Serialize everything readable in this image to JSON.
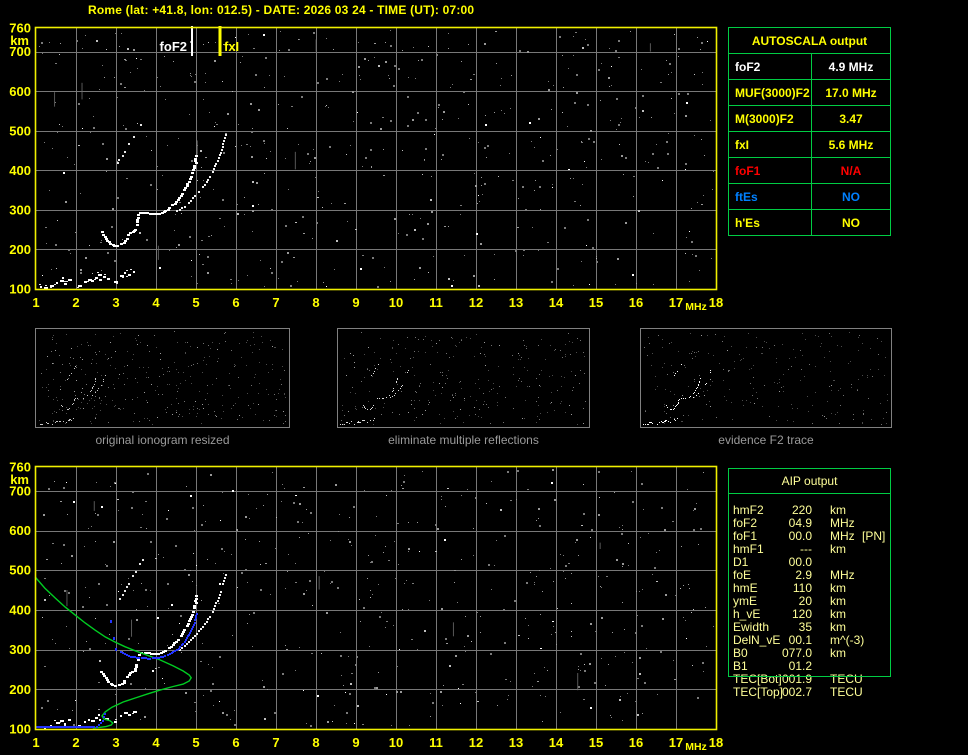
{
  "title": "Rome (lat: +41.8, lon: 012.5) - DATE: 2026 03 24 - TIME (UT): 07:00",
  "colors": {
    "background": "#000000",
    "title_yellow": "#ffff00",
    "plot_border_yellow": "#f0f000",
    "grid_gray": "#787878",
    "table_border_green": "#00cc44",
    "autoscala_white": "#ffffff",
    "autoscala_yellow": "#ffff00",
    "autoscala_red": "#ff0000",
    "autoscala_blue": "#0080ff",
    "aip_text": "#ffff99",
    "caption_gray": "#9a9a9a",
    "profile_green": "#00cc22",
    "fitted_blue": "#2233ff",
    "echo_white": "#ffffff"
  },
  "autoscala": {
    "header": "AUTOSCALA output",
    "rows": [
      {
        "label": "foF2",
        "value": "4.9 MHz",
        "color": "white"
      },
      {
        "label": "MUF(3000)F2",
        "value": "17.0 MHz",
        "color": "yellow"
      },
      {
        "label": "M(3000)F2",
        "value": "3.47",
        "color": "yellow"
      },
      {
        "label": "fxI",
        "value": "5.6 MHz",
        "color": "yellow"
      },
      {
        "label": "foF1",
        "value": "N/A",
        "color": "red"
      },
      {
        "label": "ftEs",
        "value": "NO",
        "color": "blue"
      },
      {
        "label": "h'Es",
        "value": "NO",
        "color": "yellow"
      }
    ]
  },
  "aip": {
    "header": "AIP output",
    "rows": [
      {
        "label": "hmF2",
        "value": "220",
        "unit": "km",
        "extra": ""
      },
      {
        "label": "foF2",
        "value": "04.9",
        "unit": "MHz",
        "extra": ""
      },
      {
        "label": "foF1",
        "value": "00.0",
        "unit": "MHz",
        "extra": "[PN]"
      },
      {
        "label": "hmF1",
        "value": "---",
        "unit": "km",
        "extra": ""
      },
      {
        "label": "D1",
        "value": "00.0",
        "unit": "",
        "extra": ""
      },
      {
        "label": "foE",
        "value": "2.9",
        "unit": "MHz",
        "extra": ""
      },
      {
        "label": "hmE",
        "value": "110",
        "unit": "km",
        "extra": ""
      },
      {
        "label": "ymE",
        "value": "20",
        "unit": "km",
        "extra": ""
      },
      {
        "label": "h_vE",
        "value": "120",
        "unit": "km",
        "extra": ""
      },
      {
        "label": "Ewidth",
        "value": "35",
        "unit": "km",
        "extra": ""
      },
      {
        "label": "DelN_vE",
        "value": "00.1",
        "unit": "m^(-3)",
        "extra": ""
      },
      {
        "label": "B0",
        "value": "077.0",
        "unit": "km",
        "extra": ""
      },
      {
        "label": "B1",
        "value": "01.2",
        "unit": "",
        "extra": ""
      },
      {
        "label": "TEC[Bot]",
        "value": "001.9",
        "unit": "TECU",
        "extra": ""
      },
      {
        "label": "TEC[Top]",
        "value": "002.7",
        "unit": "TECU",
        "extra": ""
      }
    ]
  },
  "thumbnails": [
    {
      "caption": "original ionogram resized"
    },
    {
      "caption": "eliminate multiple reflections"
    },
    {
      "caption": "evidence F2 trace"
    }
  ],
  "noise": {
    "seed": 20260324,
    "top_count": 560,
    "bottom_count": 540,
    "streaks_per_plot": 7,
    "thumb_counts": [
      330,
      260,
      230
    ]
  },
  "chart_data": [
    {
      "id": "top-ionogram",
      "type": "scatter",
      "xlabel": "MHz",
      "ylabel": "km",
      "xlim": [
        1,
        18
      ],
      "ylim": [
        100,
        760
      ],
      "x_ticks": [
        1,
        2,
        3,
        4,
        5,
        6,
        7,
        8,
        9,
        10,
        11,
        12,
        13,
        14,
        15,
        16,
        17,
        18
      ],
      "y_ticks": [
        760,
        700,
        600,
        500,
        400,
        300,
        200,
        100
      ],
      "grid": true,
      "markers": [
        {
          "name": "foF2",
          "freq_mhz": 4.9,
          "color": "#ffffff"
        },
        {
          "name": "fxI",
          "freq_mhz": 5.6,
          "color": "#ffff00"
        }
      ],
      "series": [
        {
          "name": "e_region_echoes",
          "points": [
            [
              1.1,
              108
            ],
            [
              1.2,
              105
            ],
            [
              1.35,
              110
            ],
            [
              1.5,
              118
            ],
            [
              1.6,
              122
            ],
            [
              1.7,
              116
            ],
            [
              1.8,
              125
            ],
            [
              2.05,
              110
            ],
            [
              2.2,
              120
            ],
            [
              2.3,
              126
            ],
            [
              2.38,
              122
            ],
            [
              2.48,
              130
            ],
            [
              2.58,
              125
            ],
            [
              2.68,
              132
            ],
            [
              2.78,
              128
            ],
            [
              2.55,
              138
            ],
            [
              2.95,
              120
            ],
            [
              3.1,
              136
            ],
            [
              3.2,
              142
            ],
            [
              3.3,
              138
            ],
            [
              3.42,
              146
            ]
          ]
        },
        {
          "name": "f2_ordinary_trace",
          "points": [
            [
              2.62,
              243
            ],
            [
              2.66,
              236
            ],
            [
              2.7,
              229
            ],
            [
              2.75,
              222
            ],
            [
              2.81,
              216
            ],
            [
              2.88,
              212
            ],
            [
              2.96,
              209
            ],
            [
              3.04,
              209
            ],
            [
              3.11,
              212
            ],
            [
              3.17,
              217
            ],
            [
              3.22,
              224
            ],
            [
              3.27,
              232
            ],
            [
              3.31,
              241
            ],
            [
              3.45,
              246
            ],
            [
              3.48,
              256
            ],
            [
              3.5,
              266
            ],
            [
              3.51,
              276
            ],
            [
              3.53,
              285
            ],
            [
              3.57,
              291
            ],
            [
              3.65,
              293
            ],
            [
              3.75,
              292
            ],
            [
              3.85,
              290
            ],
            [
              3.95,
              289
            ],
            [
              4.05,
              290
            ],
            [
              4.15,
              293
            ],
            [
              4.25,
              299
            ],
            [
              4.35,
              307
            ],
            [
              4.45,
              317
            ],
            [
              4.55,
              329
            ],
            [
              4.64,
              342
            ],
            [
              4.72,
              356
            ],
            [
              4.79,
              370
            ],
            [
              4.85,
              384
            ],
            [
              4.9,
              398
            ],
            [
              4.94,
              412
            ],
            [
              4.97,
              426
            ],
            [
              4.99,
              438
            ]
          ]
        },
        {
          "name": "f2_extraordinary_trace",
          "points": [
            [
              4.5,
              296
            ],
            [
              4.6,
              302
            ],
            [
              4.7,
              309
            ],
            [
              4.8,
              318
            ],
            [
              4.9,
              328
            ],
            [
              5.0,
              339
            ],
            [
              5.1,
              351
            ],
            [
              5.2,
              364
            ],
            [
              5.29,
              378
            ],
            [
              5.37,
              392
            ],
            [
              5.44,
              406
            ],
            [
              5.5,
              420
            ],
            [
              5.56,
              435
            ],
            [
              5.61,
              450
            ],
            [
              5.65,
              464
            ],
            [
              5.69,
              478
            ],
            [
              5.72,
              491
            ]
          ]
        },
        {
          "name": "upper_spread_echo",
          "points": [
            [
              3.02,
              420
            ],
            [
              3.08,
              431
            ],
            [
              3.15,
              443
            ],
            [
              3.22,
              455
            ],
            [
              3.3,
              467
            ],
            [
              3.37,
              478
            ],
            [
              3.44,
              490
            ],
            [
              3.51,
              502
            ],
            [
              3.57,
              513
            ],
            [
              3.63,
              525
            ],
            [
              3.68,
              536
            ]
          ]
        }
      ]
    },
    {
      "id": "bottom-ionogram",
      "type": "scatter",
      "xlabel": "MHz",
      "ylabel": "km",
      "xlim": [
        1,
        18
      ],
      "ylim": [
        100,
        760
      ],
      "x_ticks": [
        1,
        2,
        3,
        4,
        5,
        6,
        7,
        8,
        9,
        10,
        11,
        12,
        13,
        14,
        15,
        16,
        17,
        18
      ],
      "y_ticks": [
        760,
        700,
        600,
        500,
        400,
        300,
        200,
        100
      ],
      "grid": true,
      "background_points": "same white echo series as top-ionogram",
      "profile": {
        "name": "electron_density_profile_green",
        "points": [
          [
            0.98,
            483
          ],
          [
            1.22,
            455
          ],
          [
            1.48,
            430
          ],
          [
            1.73,
            407
          ],
          [
            1.98,
            387
          ],
          [
            2.23,
            367
          ],
          [
            2.48,
            349
          ],
          [
            2.73,
            332
          ],
          [
            2.98,
            319
          ],
          [
            3.23,
            307
          ],
          [
            3.48,
            297
          ],
          [
            3.78,
            286
          ],
          [
            4.1,
            274
          ],
          [
            4.43,
            259
          ],
          [
            4.68,
            246
          ],
          [
            4.83,
            236
          ],
          [
            4.88,
            229
          ],
          [
            4.83,
            221
          ],
          [
            4.68,
            213
          ],
          [
            4.43,
            207
          ],
          [
            4.1,
            198
          ],
          [
            3.78,
            188
          ],
          [
            3.48,
            178
          ],
          [
            3.18,
            168
          ],
          [
            2.9,
            155
          ],
          [
            2.73,
            143
          ],
          [
            2.65,
            133
          ],
          [
            2.7,
            125
          ],
          [
            2.85,
            121
          ],
          [
            2.92,
            115
          ],
          [
            2.88,
            110
          ],
          [
            2.75,
            106
          ],
          [
            2.58,
            104
          ],
          [
            2.42,
            103
          ]
        ]
      },
      "fitted_trace": {
        "name": "restored_trace_blue",
        "bottom_row": {
          "f_start": 1.0,
          "f_end": 2.45,
          "alt_km": 104
        },
        "riser_points": [
          [
            2.5,
            105
          ],
          [
            2.55,
            109
          ],
          [
            2.6,
            114
          ],
          [
            2.64,
            121
          ],
          [
            2.67,
            129
          ],
          [
            2.7,
            137
          ]
        ],
        "isolated_points": [
          [
            2.85,
            375
          ],
          [
            2.92,
            332
          ],
          [
            2.98,
            304
          ]
        ],
        "arc_points": [
          [
            3.1,
            294
          ],
          [
            3.3,
            282
          ],
          [
            3.55,
            279
          ],
          [
            3.8,
            277
          ],
          [
            4.05,
            279
          ],
          [
            4.3,
            287
          ],
          [
            4.52,
            299
          ],
          [
            4.68,
            317
          ],
          [
            4.8,
            337
          ],
          [
            4.9,
            356
          ],
          [
            4.95,
            372
          ],
          [
            4.99,
            390
          ]
        ]
      }
    }
  ]
}
